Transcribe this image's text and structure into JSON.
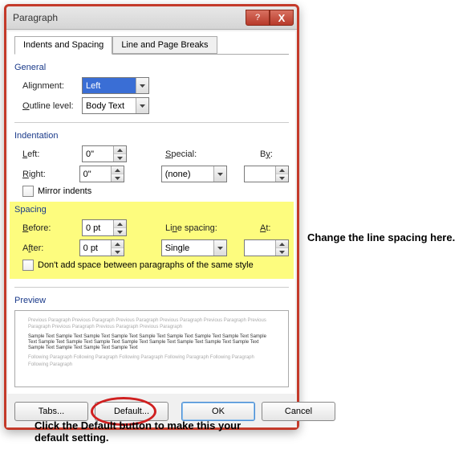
{
  "title": "Paragraph",
  "tabs": {
    "active": "Indents and Spacing",
    "inactive": "Line and Page Breaks"
  },
  "general": {
    "title": "General",
    "alignment_label": "Alignment:",
    "alignment_value": "Left",
    "outline_label": "Outline level:",
    "outline_value": "Body Text"
  },
  "indentation": {
    "title": "Indentation",
    "left_label": "Left:",
    "left_value": "0\"",
    "right_label": "Right:",
    "right_value": "0\"",
    "special_label": "Special:",
    "special_value": "(none)",
    "by_label": "By:",
    "by_value": "",
    "mirror_label": "Mirror indents"
  },
  "spacing": {
    "title": "Spacing",
    "before_label": "Before:",
    "before_value": "0 pt",
    "after_label": "After:",
    "after_value": "0 pt",
    "line_label": "Line spacing:",
    "line_value": "Single",
    "at_label": "At:",
    "at_value": "",
    "dont_add_label": "Don't add space between paragraphs of the same style"
  },
  "preview": {
    "title": "Preview",
    "filler": "Previous Paragraph Previous Paragraph Previous Paragraph Previous Paragraph Previous Paragraph Previous Paragraph Previous Paragraph Previous Paragraph Previous Paragraph",
    "sample": "Sample Text Sample Text Sample Text Sample Text Sample Text Sample Text Sample Text Sample Text Sample Text Sample Text Sample Text Sample Text Sample Text Sample Text Sample Text Sample Text Sample Text Sample Text Sample Text Sample Text Sample Text",
    "filler2": "Following Paragraph Following Paragraph Following Paragraph Following Paragraph Following Paragraph Following Paragraph"
  },
  "buttons": {
    "tabs": "Tabs...",
    "default": "Default...",
    "ok": "OK",
    "cancel": "Cancel"
  },
  "annotations": {
    "line_spacing": "Change the line spacing here.",
    "default_btn": "Click the Default button to make this your default setting."
  }
}
